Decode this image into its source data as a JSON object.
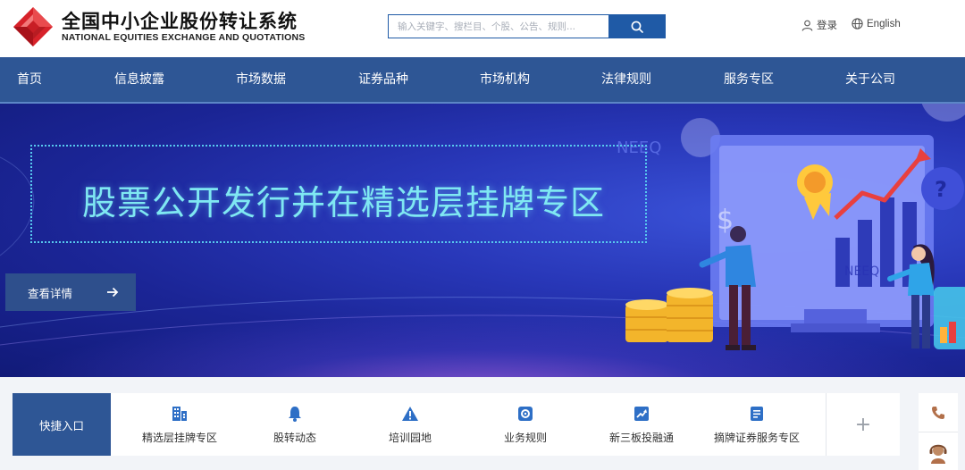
{
  "header": {
    "logo_cn": "全国中小企业股份转让系统",
    "logo_en": "NATIONAL EQUITIES EXCHANGE AND QUOTATIONS",
    "search_placeholder": "输入关键字、搜栏目、个股、公告、规则...",
    "login_label": "登录",
    "language_label": "English"
  },
  "nav": {
    "items": [
      "首页",
      "信息披露",
      "市场数据",
      "证券品种",
      "市场机构",
      "法律规则",
      "服务专区",
      "关于公司"
    ]
  },
  "banner": {
    "title": "股票公开发行并在精选层挂牌专区",
    "button_label": "查看详情",
    "art_text_1": "NEEQ",
    "art_text_2": "NEEQ"
  },
  "quick": {
    "label": "快捷入口",
    "items": [
      {
        "label": "精选层挂牌专区",
        "icon": "building-icon"
      },
      {
        "label": "股转动态",
        "icon": "bell-icon"
      },
      {
        "label": "培训园地",
        "icon": "warning-icon"
      },
      {
        "label": "业务规则",
        "icon": "gear-icon"
      },
      {
        "label": "新三板投融通",
        "icon": "trend-chart-icon"
      },
      {
        "label": "摘牌证券服务专区",
        "icon": "document-icon"
      }
    ],
    "plus": "+"
  },
  "colors": {
    "brand_blue": "#2e5695",
    "accent_blue": "#1f5aa6",
    "logo_red": "#d7222a",
    "banner_title": "#7fe8f2"
  }
}
